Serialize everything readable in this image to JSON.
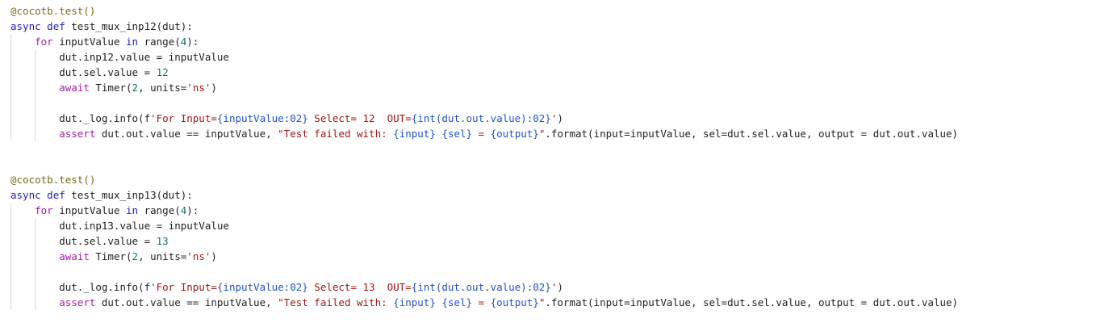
{
  "editor": {
    "blocks": [
      {
        "lines": [
          [
            [
              "dec",
              "@cocotb.test()"
            ]
          ],
          [
            [
              "kw",
              "async"
            ],
            [
              "pl",
              " "
            ],
            [
              "kw",
              "def"
            ],
            [
              "pl",
              " test_mux_inp12(dut):"
            ]
          ],
          [
            [
              "pl",
              "    "
            ],
            [
              "ctl",
              "for"
            ],
            [
              "pl",
              " inputValue "
            ],
            [
              "kw",
              "in"
            ],
            [
              "pl",
              " range("
            ],
            [
              "num",
              "4"
            ],
            [
              "pl",
              "):"
            ]
          ],
          [
            [
              "pl",
              "        dut.inp12.value = inputValue"
            ]
          ],
          [
            [
              "pl",
              "        dut.sel.value = "
            ],
            [
              "num",
              "12"
            ]
          ],
          [
            [
              "pl",
              "        "
            ],
            [
              "ctl",
              "await"
            ],
            [
              "pl",
              " Timer("
            ],
            [
              "num",
              "2"
            ],
            [
              "pl",
              ", units="
            ],
            [
              "str",
              "'ns'"
            ],
            [
              "pl",
              ")"
            ]
          ],
          [
            [
              "pl",
              ""
            ]
          ],
          [
            [
              "pl",
              "        dut._log.info(f"
            ],
            [
              "str",
              "'For Input="
            ],
            [
              "esc",
              "{inputValue:02}"
            ],
            [
              "str",
              " Select= 12  OUT="
            ],
            [
              "esc",
              "{int(dut.out.value):02}"
            ],
            [
              "str",
              "'"
            ],
            [
              "pl",
              ")"
            ]
          ],
          [
            [
              "pl",
              "        "
            ],
            [
              "ctl",
              "assert"
            ],
            [
              "pl",
              " dut.out.value == inputValue, "
            ],
            [
              "str",
              "\"Test failed with: "
            ],
            [
              "esc",
              "{input}"
            ],
            [
              "str",
              " "
            ],
            [
              "esc",
              "{sel}"
            ],
            [
              "str",
              " = "
            ],
            [
              "esc",
              "{output}"
            ],
            [
              "str",
              "\""
            ],
            [
              "pl",
              ".format(input=inputValue, sel=dut.sel.value, output = dut.out.value)"
            ]
          ]
        ]
      },
      {
        "lines": [
          [
            [
              "dec",
              "@cocotb.test()"
            ]
          ],
          [
            [
              "kw",
              "async"
            ],
            [
              "pl",
              " "
            ],
            [
              "kw",
              "def"
            ],
            [
              "pl",
              " test_mux_inp13(dut):"
            ]
          ],
          [
            [
              "pl",
              "    "
            ],
            [
              "ctl",
              "for"
            ],
            [
              "pl",
              " inputValue "
            ],
            [
              "kw",
              "in"
            ],
            [
              "pl",
              " range("
            ],
            [
              "num",
              "4"
            ],
            [
              "pl",
              "):"
            ]
          ],
          [
            [
              "pl",
              "        dut.inp13.value = inputValue"
            ]
          ],
          [
            [
              "pl",
              "        dut.sel.value = "
            ],
            [
              "num",
              "13"
            ]
          ],
          [
            [
              "pl",
              "        "
            ],
            [
              "ctl",
              "await"
            ],
            [
              "pl",
              " Timer("
            ],
            [
              "num",
              "2"
            ],
            [
              "pl",
              ", units="
            ],
            [
              "str",
              "'ns'"
            ],
            [
              "pl",
              ")"
            ]
          ],
          [
            [
              "pl",
              ""
            ]
          ],
          [
            [
              "pl",
              "        dut._log.info(f"
            ],
            [
              "str",
              "'For Input="
            ],
            [
              "esc",
              "{inputValue:02}"
            ],
            [
              "str",
              " Select= 13  OUT="
            ],
            [
              "esc",
              "{int(dut.out.value):02}"
            ],
            [
              "str",
              "'"
            ],
            [
              "pl",
              ")"
            ]
          ],
          [
            [
              "pl",
              "        "
            ],
            [
              "ctl",
              "assert"
            ],
            [
              "pl",
              " dut.out.value == inputValue, "
            ],
            [
              "str",
              "\"Test failed with: "
            ],
            [
              "esc",
              "{input}"
            ],
            [
              "str",
              " "
            ],
            [
              "esc",
              "{sel}"
            ],
            [
              "str",
              " = "
            ],
            [
              "esc",
              "{output}"
            ],
            [
              "str",
              "\""
            ],
            [
              "pl",
              ".format(input=inputValue, sel=dut.sel.value, output = dut.out.value)"
            ]
          ]
        ]
      }
    ]
  }
}
